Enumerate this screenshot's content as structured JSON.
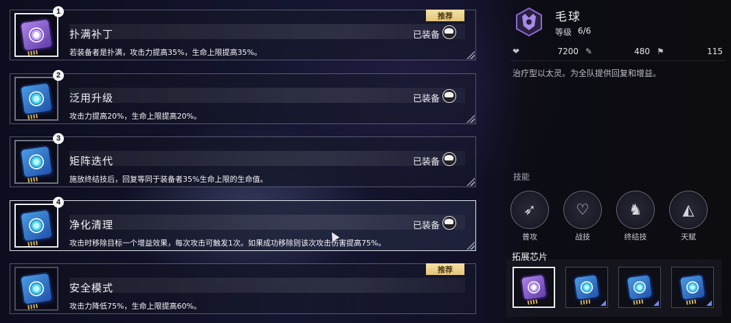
{
  "chips": [
    {
      "badge": "1",
      "title": "扑满补丁",
      "status": "已装备",
      "recommended": "推荐",
      "desc": "若装备者是扑满，攻击力提高35%，生命上限提高35%。"
    },
    {
      "badge": "2",
      "title": "泛用升级",
      "status": "已装备",
      "recommended": "",
      "desc": "攻击力提高20%，生命上限提高20%。"
    },
    {
      "badge": "3",
      "title": "矩阵迭代",
      "status": "已装备",
      "recommended": "",
      "desc": "施放终结技后，回复等同于装备者35%生命上限的生命值。"
    },
    {
      "badge": "4",
      "title": "净化清理",
      "status": "已装备",
      "recommended": "",
      "desc": "攻击时移除目标一个增益效果，每次攻击可触发1次。如果成功移除则该次攻击伤害提高75%。"
    },
    {
      "badge": "",
      "title": "安全模式",
      "status": "",
      "recommended": "推荐",
      "desc": "攻击力降低75%，生命上限提高60%。"
    }
  ],
  "character": {
    "name": "毛球",
    "level_label": "等级",
    "level_value": "6/6",
    "stats": [
      "7200",
      "480",
      "115"
    ],
    "role": "治疗型以太灵。为全队提供回复和增益。"
  },
  "skills_title": "技能",
  "skills": [
    "普攻",
    "战技",
    "终结技",
    "天赋"
  ],
  "ext_chips_title": "拓展芯片",
  "colors": {
    "recommend_tag": "#e8c97f",
    "selected_border": "#f0f2f8",
    "chip_blue": "#3d7fd6",
    "chip_purple": "#8c63d6"
  }
}
